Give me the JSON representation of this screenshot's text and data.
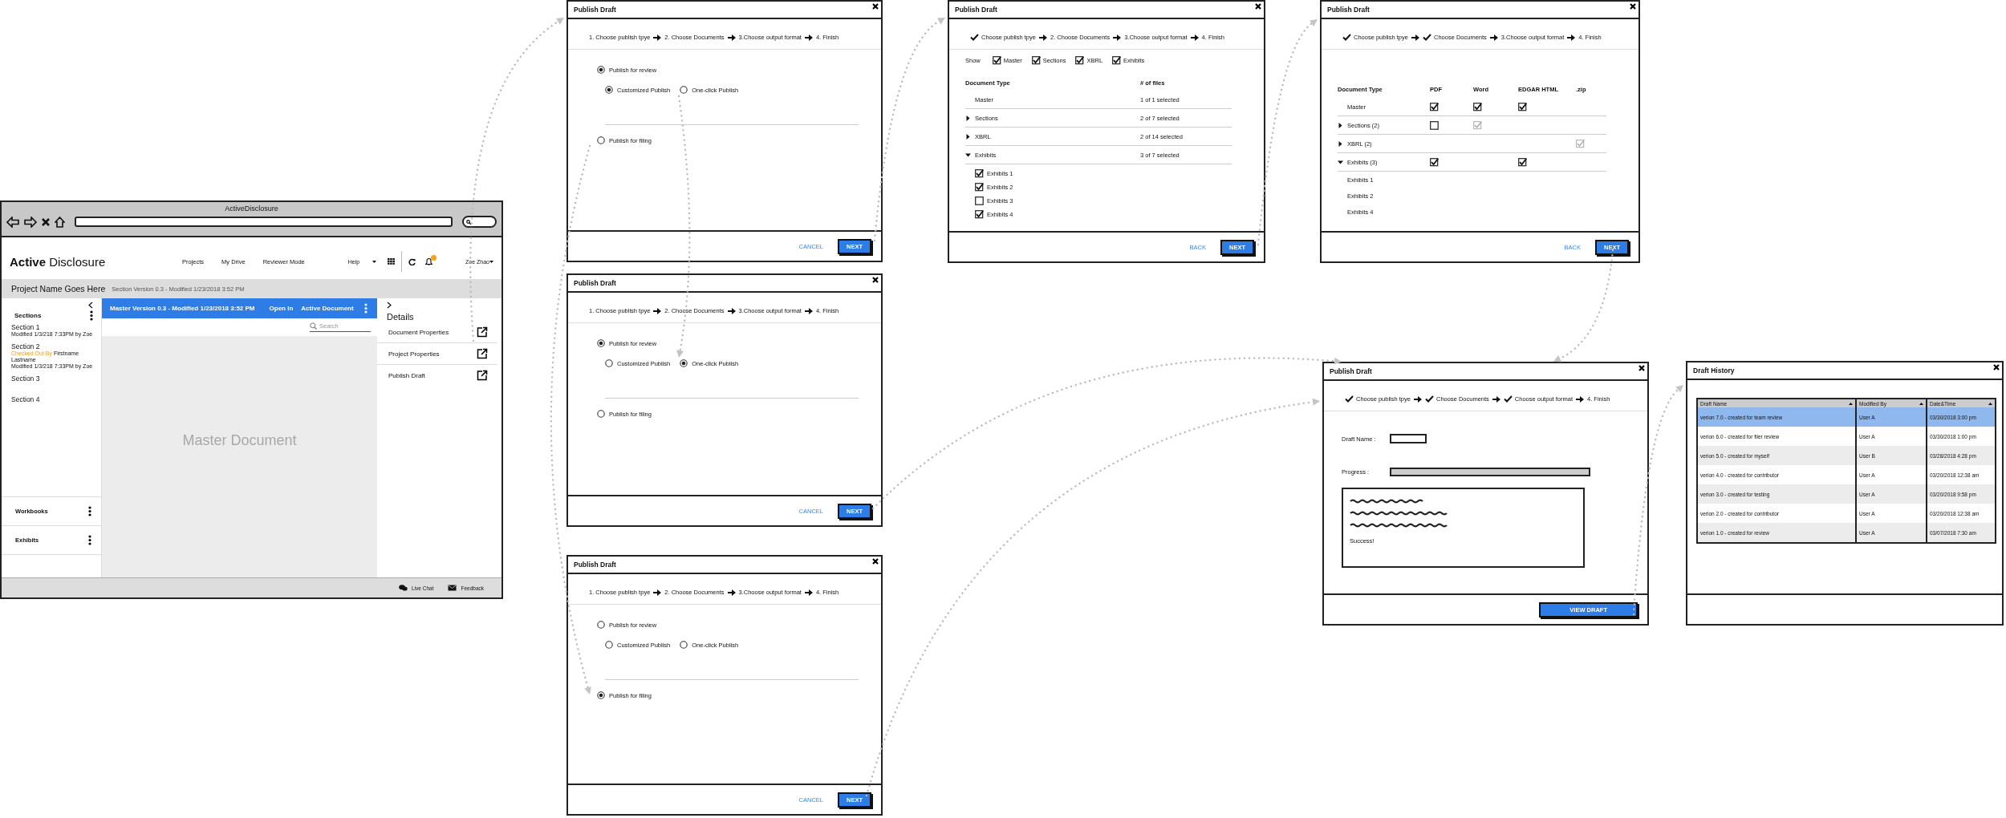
{
  "app_window": {
    "title": "ActiveDisclosure",
    "logo": "**Active** Disclosure",
    "nav": [
      "Projects",
      "My Drive",
      "Reviewer Mode"
    ],
    "help": "Help",
    "user": "Zoe Zhao",
    "project": {
      "name": "Project Name Goes Here",
      "subtitle": "Section Version 0.3 - Modified 1/23/2018 3:52 PM"
    },
    "sidebar": {
      "heading": "Sections",
      "items": [
        {
          "title": "Section 1",
          "modified": "Modified 1/3/218 7:33PM by Zoe"
        },
        {
          "title": "Section 2",
          "checked_out": {
            "label": "Checked Out By",
            "name": "Firstname Lastname"
          },
          "modified": "Modified 1/3/218 7:33PM by Zoe"
        },
        {
          "title": "Section 3"
        },
        {
          "title": "Section 4"
        }
      ],
      "panels": [
        "Workbooks",
        "Exhibits"
      ]
    },
    "document": {
      "title": "Master Version 0.3 - Modified 1/23/2018 3:52 PM",
      "actions": [
        "Open In",
        "Active Document"
      ],
      "search": {
        "placeholder": "Search"
      },
      "watermark": "Master Document"
    },
    "details": {
      "heading": "Details",
      "items": [
        "Document Properties",
        "Project Properties",
        "Publish Draft"
      ]
    },
    "footer": [
      {
        "kind": "chat",
        "label": "Live Chat"
      },
      {
        "kind": "mail",
        "label": "Feedback"
      }
    ]
  },
  "dialogs": [
    {
      "kind": "type",
      "title": "Publish Draft",
      "steps": [
        {
          "label": "1. Choose publish tpye",
          "done": false
        },
        {
          "label": "2. Choose Documents",
          "done": false
        },
        {
          "label": "3.Choose output format",
          "done": false
        },
        {
          "label": "4. Finish",
          "done": false
        }
      ],
      "options": [
        {
          "label": "Publish for review",
          "selected": true,
          "children": [
            {
              "label": "Customized Publish",
              "selected": true
            },
            {
              "label": "One-click Publish",
              "selected": false
            }
          ]
        },
        {
          "label": "Publish for filing",
          "selected": false
        }
      ],
      "buttons": [
        {
          "kind": "link",
          "label": "CANCEL"
        },
        {
          "kind": "primary",
          "label": "NEXT"
        }
      ]
    },
    {
      "kind": "type",
      "title": "Publish Draft",
      "steps": [
        {
          "label": "1. Choose publish tpye",
          "done": false
        },
        {
          "label": "2. Choose Documents",
          "done": false
        },
        {
          "label": "3.Choose output format",
          "done": false
        },
        {
          "label": "4. Finish",
          "done": false
        }
      ],
      "options": [
        {
          "label": "Publish for review",
          "selected": true,
          "children": [
            {
              "label": "Customized Publish",
              "selected": false
            },
            {
              "label": "One-click Publish",
              "selected": true
            }
          ]
        },
        {
          "label": "Publish for filing",
          "selected": false
        }
      ],
      "buttons": [
        {
          "kind": "link",
          "label": "CANCEL"
        },
        {
          "kind": "primary",
          "label": "NEXT"
        }
      ]
    },
    {
      "kind": "type",
      "title": "Publish Draft",
      "steps": [
        {
          "label": "1. Choose publish tpye",
          "done": false
        },
        {
          "label": "2. Choose Documents",
          "done": false
        },
        {
          "label": "3.Choose output format",
          "done": false
        },
        {
          "label": "4. Finish",
          "done": false
        }
      ],
      "options": [
        {
          "label": "Publish for review",
          "selected": false,
          "children": [
            {
              "label": "Customized Publish",
              "selected": false
            },
            {
              "label": "One-click Publish",
              "selected": false
            }
          ]
        },
        {
          "label": "Publish for filing",
          "selected": true
        }
      ],
      "buttons": [
        {
          "kind": "link",
          "label": "CANCEL"
        },
        {
          "kind": "primary",
          "label": "NEXT"
        }
      ]
    },
    {
      "kind": "documents",
      "title": "Publish Draft",
      "steps": [
        {
          "label": "Choose publish tpye",
          "done": true
        },
        {
          "label": "2. Choose Documents",
          "done": false
        },
        {
          "label": "3.Choose output format",
          "done": false
        },
        {
          "label": "4. Finish",
          "done": false
        }
      ],
      "show_label": "Show",
      "filters": [
        {
          "label": "Master",
          "checked": true
        },
        {
          "label": "Sections",
          "checked": true
        },
        {
          "label": "XBRL",
          "checked": true
        },
        {
          "label": "Exhibits",
          "checked": true
        }
      ],
      "columns": [
        "Document Type",
        "# of files"
      ],
      "rows": [
        {
          "kind": "leaf",
          "label": "Master",
          "count": "1 of 1 selected"
        },
        {
          "kind": "group",
          "label": "Sections",
          "count": "2 of 7 selected",
          "expanded": false
        },
        {
          "kind": "group",
          "label": "XBRL",
          "count": "2 of 14 selected",
          "expanded": false
        },
        {
          "kind": "group",
          "label": "Exhibits",
          "count": "3 of 7 selected",
          "expanded": true,
          "children": [
            {
              "label": "Exhibits 1",
              "checked": true
            },
            {
              "label": "Exhibits 2",
              "checked": true
            },
            {
              "label": "Exhibits 3",
              "checked": false
            },
            {
              "label": "Exhibits 4",
              "checked": true
            }
          ]
        }
      ],
      "buttons": [
        {
          "kind": "link",
          "label": "BACK"
        },
        {
          "kind": "primary",
          "label": "NEXT"
        }
      ]
    },
    {
      "kind": "formats",
      "title": "Publish Draft",
      "steps": [
        {
          "label": "Choose publish tpye",
          "done": true
        },
        {
          "label": "Choose Documents",
          "done": true
        },
        {
          "label": "3.Choose output format",
          "done": false
        },
        {
          "label": "4. Finish",
          "done": false
        }
      ],
      "columns": [
        "Document Type",
        "PDF",
        "Word",
        "EDGAR HTML",
        ".zip"
      ],
      "rows": [
        {
          "kind": "leaf",
          "label": "Master",
          "cells": [
            {
              "kind": "checkbox",
              "checked": true,
              "disabled": false
            },
            {
              "kind": "checkbox",
              "checked": true,
              "disabled": false
            },
            {
              "kind": "checkbox",
              "checked": true,
              "disabled": false
            },
            {
              "kind": "empty"
            }
          ]
        },
        {
          "kind": "group",
          "label": "Sections (2)",
          "expanded": false,
          "cells": [
            {
              "kind": "checkbox",
              "checked": false,
              "disabled": false
            },
            {
              "kind": "checkbox",
              "checked": true,
              "disabled": true
            },
            {
              "kind": "empty"
            },
            {
              "kind": "empty"
            }
          ]
        },
        {
          "kind": "group",
          "label": "XBRL (2)",
          "expanded": false,
          "cells": [
            {
              "kind": "empty"
            },
            {
              "kind": "empty"
            },
            {
              "kind": "empty"
            },
            {
              "kind": "checkbox",
              "checked": true,
              "disabled": true
            }
          ]
        },
        {
          "kind": "group",
          "label": "Exhibits  (3)",
          "expanded": true,
          "cells": [
            {
              "kind": "checkbox",
              "checked": true,
              "disabled": false
            },
            {
              "kind": "empty"
            },
            {
              "kind": "checkbox",
              "checked": true,
              "disabled": false
            },
            {
              "kind": "empty"
            }
          ],
          "children": [
            "Exhibits 1",
            "Exhibits 2",
            "Exhibits 4"
          ]
        }
      ],
      "buttons": [
        {
          "kind": "link",
          "label": "BACK"
        },
        {
          "kind": "primary",
          "label": "NEXT"
        }
      ]
    },
    {
      "kind": "progress",
      "title": "Publish Draft",
      "steps": [
        {
          "label": "Choose publish tpye",
          "done": true
        },
        {
          "label": "Choose Documents",
          "done": true
        },
        {
          "label": "Choose output format",
          "done": true
        },
        {
          "label": "4. Finish",
          "done": false
        }
      ],
      "draft_name_label": "Draft Name :",
      "progress_label": "Progress :",
      "level": 1,
      "log_result": "Success!",
      "buttons": [
        {
          "kind": "primary",
          "label": "VIEW DRAFT"
        }
      ]
    },
    {
      "kind": "history",
      "title": "Draft History",
      "columns": [
        "Draft Name",
        "Modified By",
        "Date&Time"
      ],
      "rows": [
        {
          "cells": [
            "verion 7.0 - created for team review",
            "User A",
            "03/30/2018 3:00 pm"
          ],
          "selected": true
        },
        {
          "cells": [
            "verion 6.0 - created for filer review",
            "User A",
            "03/30/2018 1:00 pm"
          ],
          "selected": false
        },
        {
          "cells": [
            "verion 5.0 - created for myself",
            "User B",
            "03/28/2018 4:28 pm"
          ],
          "selected": false
        },
        {
          "cells": [
            "verion 4.0 - created for contributor",
            "User A",
            "03/20/2018 12:38 am"
          ],
          "selected": false
        },
        {
          "cells": [
            "verion 3.0 - created for testing",
            "User A",
            "03/20/2018 9:58 pm"
          ],
          "selected": false
        },
        {
          "cells": [
            "verion 2.0 - created for contributor",
            "User A",
            "03/20/2018 12:38 am"
          ],
          "selected": false
        },
        {
          "cells": [
            "verion 1.0 - created for review",
            "User A",
            "03/07/2018 7:30 am"
          ],
          "selected": false
        }
      ]
    }
  ]
}
